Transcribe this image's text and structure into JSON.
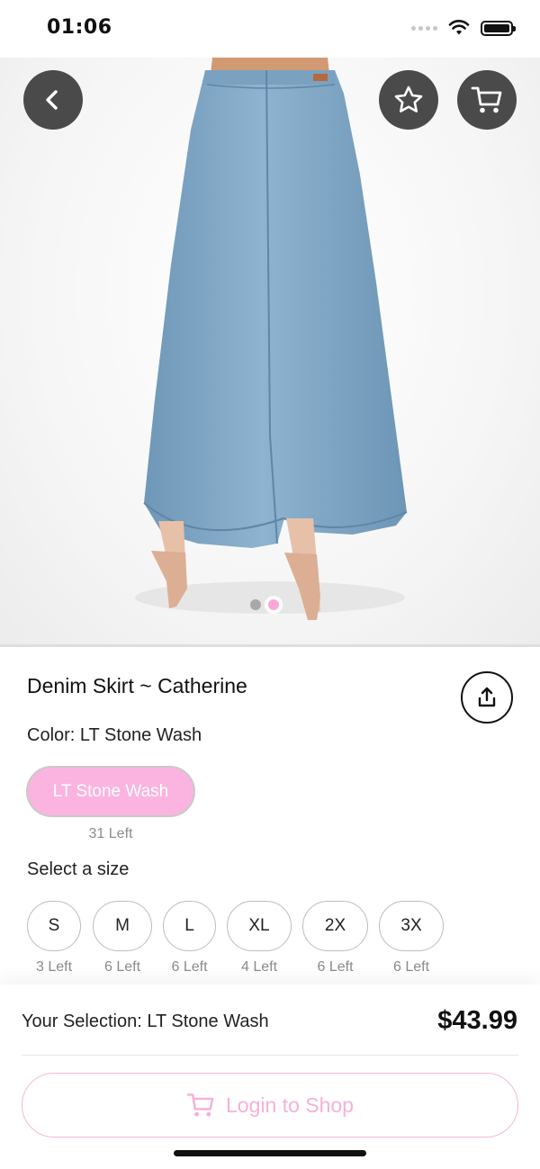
{
  "status_bar": {
    "time": "01:06"
  },
  "hero": {
    "image_alt": "light wash denim maxi skirt, back view",
    "page_count": 2,
    "active_page": 2
  },
  "header_icons": {
    "back": "chevron-left-icon",
    "favorite": "star-icon",
    "cart": "cart-icon"
  },
  "product": {
    "title": "Denim Skirt ~ Catherine",
    "color_label": "Color:",
    "color_value": "LT Stone Wash",
    "colors": [
      {
        "label": "LT Stone Wash",
        "stock": "31 Left"
      }
    ],
    "size_label": "Select a size",
    "sizes": [
      {
        "label": "S",
        "stock": "3 Left"
      },
      {
        "label": "M",
        "stock": "6 Left"
      },
      {
        "label": "L",
        "stock": "6 Left"
      },
      {
        "label": "XL",
        "stock": "4 Left"
      },
      {
        "label": "2X",
        "stock": "6 Left"
      },
      {
        "label": "3X",
        "stock": "6 Left"
      }
    ]
  },
  "bottom": {
    "selection_text": "Your Selection: LT Stone Wash",
    "price": "$43.99",
    "login_label": "Login to Shop"
  },
  "colors": {
    "accent_pink": "#f7b0d8",
    "pill_pink": "#fbb4df",
    "button_dark": "#4a4a4a",
    "denim": "#7fa6c4"
  }
}
